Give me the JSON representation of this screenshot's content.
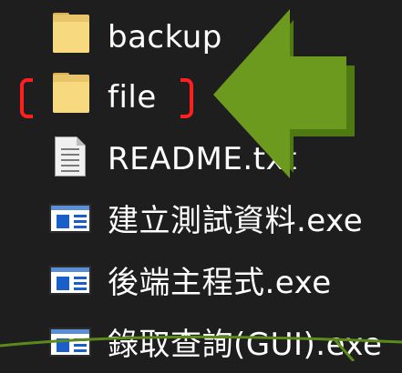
{
  "files": [
    {
      "name": "backup",
      "icon": "folder-icon"
    },
    {
      "name": "file",
      "icon": "folder-icon"
    },
    {
      "name": "README.txt",
      "icon": "text-file-icon"
    },
    {
      "name": "建立測試資料.exe",
      "icon": "exe-icon"
    },
    {
      "name": "後端主程式.exe",
      "icon": "exe-icon"
    },
    {
      "name": "錄取查詢(GUI).exe",
      "icon": "exe-icon"
    }
  ],
  "annotation": {
    "highlight_color": "#ff1f1f",
    "arrow_color": "#6b9a1f",
    "arrow_edge_color": "#4f7a12"
  },
  "colors": {
    "background": "#1e1e1e",
    "text": "#ffffff",
    "folder": "#f7d97f"
  }
}
